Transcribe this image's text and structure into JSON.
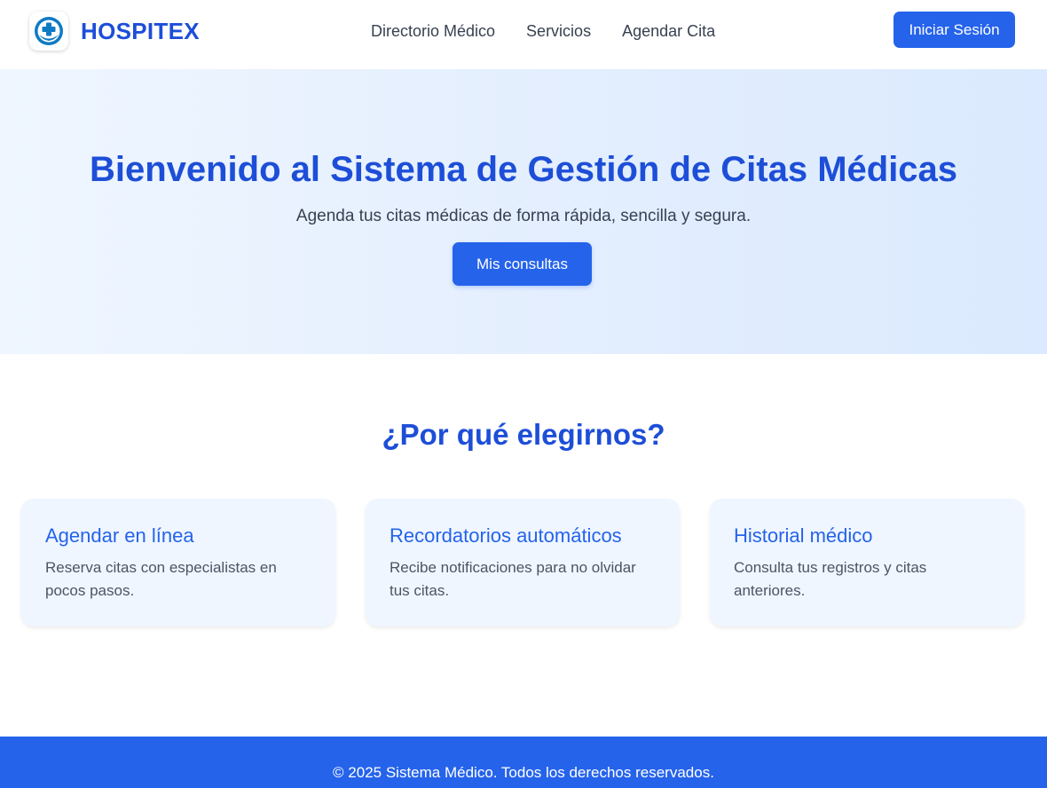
{
  "colors": {
    "primary": "#2563eb",
    "brand_text": "#1d4ed8",
    "card_bg": "#eff6ff",
    "hero_bg": "#e3eefe"
  },
  "header": {
    "logo_icon": "medical-cross-icon",
    "brand": "HOSPITEX",
    "nav": [
      {
        "label": "Directorio Médico"
      },
      {
        "label": "Servicios"
      },
      {
        "label": "Agendar Cita"
      }
    ],
    "login_label": "Iniciar Sesión"
  },
  "hero": {
    "title": "Bienvenido al Sistema de Gestión de Citas Médicas",
    "subtitle": "Agenda tus citas médicas de forma rápida, sencilla y segura.",
    "button_label": "Mis consultas"
  },
  "features": {
    "title": "¿Por qué elegirnos?",
    "cards": [
      {
        "title": "Agendar en línea",
        "text": "Reserva citas con especialistas en pocos pasos."
      },
      {
        "title": "Recordatorios automáticos",
        "text": "Recibe notificaciones para no olvidar tus citas."
      },
      {
        "title": "Historial médico",
        "text": "Consulta tus registros y citas anteriores."
      }
    ]
  },
  "footer": {
    "text": "© 2025 Sistema Médico. Todos los derechos reservados."
  }
}
